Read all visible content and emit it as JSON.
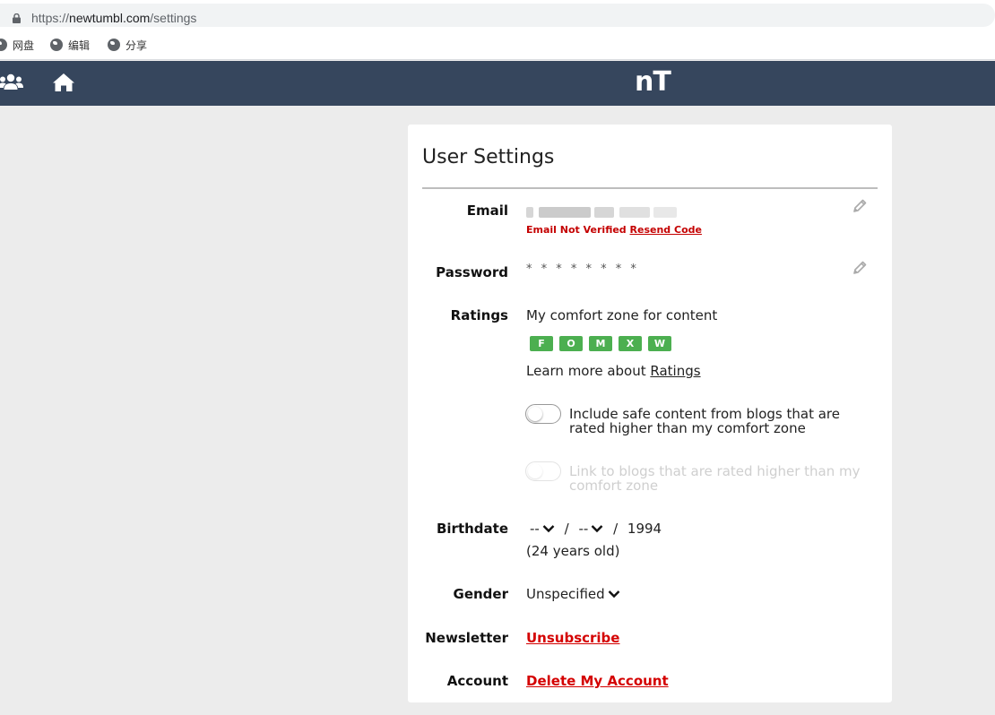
{
  "browser": {
    "url_prefix": "https://",
    "url_host": "newtumbl.com",
    "url_path": "/settings",
    "bookmarks": [
      {
        "label": "网盘",
        "icon": "globe-icon"
      },
      {
        "label": "编辑",
        "icon": "globe-icon"
      },
      {
        "label": "分享",
        "icon": "globe-icon"
      }
    ]
  },
  "navbar": {
    "logo": "nT",
    "background": "#36465d",
    "icons": [
      "users-icon",
      "home-icon"
    ]
  },
  "settings": {
    "title": "User Settings",
    "email": {
      "label": "Email",
      "status": "Email Not Verified",
      "resend": "Resend Code"
    },
    "password": {
      "label": "Password",
      "value": "* * * * * * * *"
    },
    "ratings": {
      "label": "Ratings",
      "intro": "My comfort zone for content",
      "levels": [
        "F",
        "O",
        "M",
        "X",
        "W"
      ],
      "level_color": "#4caf50",
      "learn_prefix": "Learn more about ",
      "learn_link": "Ratings",
      "option_safe": "Include safe content from blogs that are rated higher than my comfort zone",
      "option_safe_on": false,
      "option_link": "Link to blogs that are rated higher than my comfort zone",
      "option_link_on": false,
      "option_link_disabled": true
    },
    "birthdate": {
      "label": "Birthdate",
      "month": "--",
      "day": "--",
      "sep": "/",
      "year": "1994",
      "age": "(24 years old)"
    },
    "gender": {
      "label": "Gender",
      "value": "Unspecified"
    },
    "newsletter": {
      "label": "Newsletter",
      "action": "Unsubscribe"
    },
    "account": {
      "label": "Account",
      "action": "Delete My Account"
    },
    "danger_color": "#d40000"
  }
}
